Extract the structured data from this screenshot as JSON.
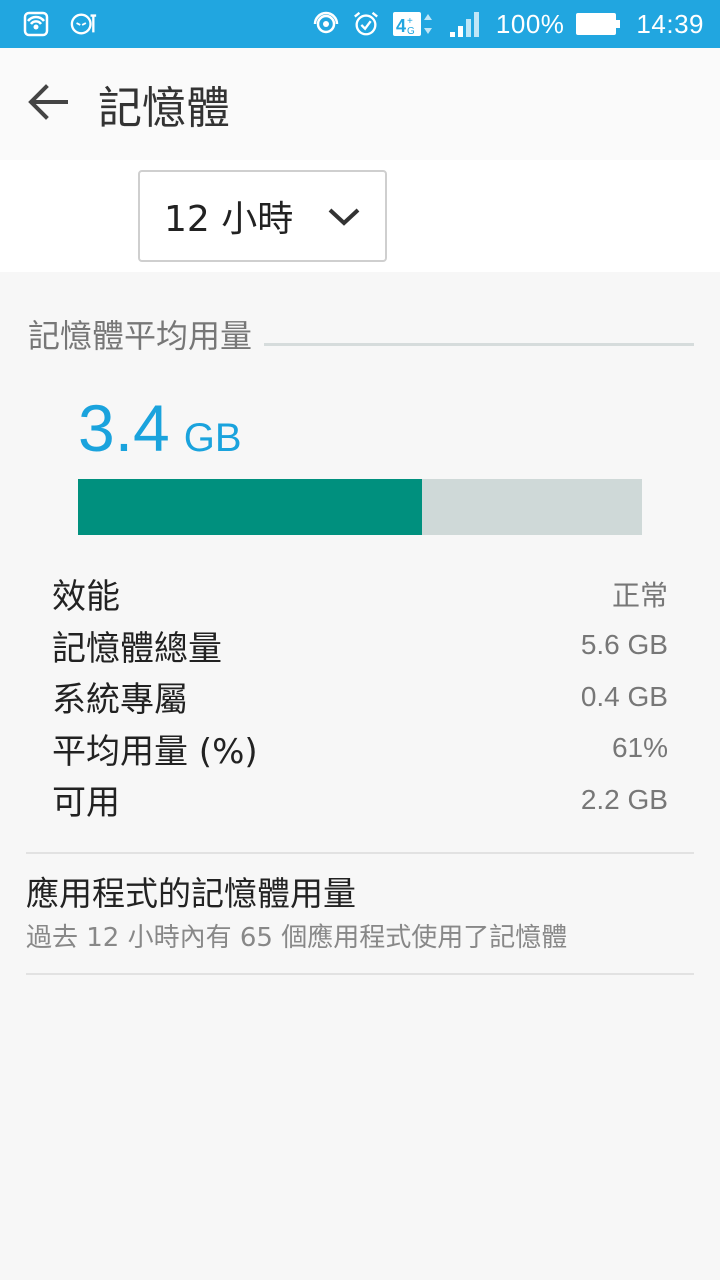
{
  "status_bar": {
    "left_icons": [
      "wireless-hotspot-icon",
      "game-genie-icon"
    ],
    "right_icons": [
      "wifi-hotspot-icon",
      "alarm-icon",
      "4g-lte-icon",
      "signal-strength-icon"
    ],
    "battery_percent": "100%",
    "battery_level": 1.0,
    "time": "14:39",
    "color": "#21a6e0"
  },
  "header": {
    "title": "記憶體"
  },
  "period_selector": {
    "selected": "12 小時"
  },
  "memory_section": {
    "title": "記憶體平均用量",
    "average_value": "3.4",
    "average_unit": "GB",
    "usage_fraction": 0.61,
    "bar_fill_color": "#00907e",
    "bar_track_color": "#cfd9d8",
    "value_color": "#1aa3dd",
    "stats": [
      {
        "label": "效能",
        "value": "正常"
      },
      {
        "label": "記憶體總量",
        "value": "5.6 GB"
      },
      {
        "label": "系統專屬",
        "value": "0.4 GB"
      },
      {
        "label": "平均用量 (%)",
        "value": "61%"
      },
      {
        "label": "可用",
        "value": "2.2 GB"
      }
    ]
  },
  "app_usage": {
    "title": "應用程式的記憶體用量",
    "subtitle": "過去 12 小時內有 65 個應用程式使用了記憶體"
  }
}
